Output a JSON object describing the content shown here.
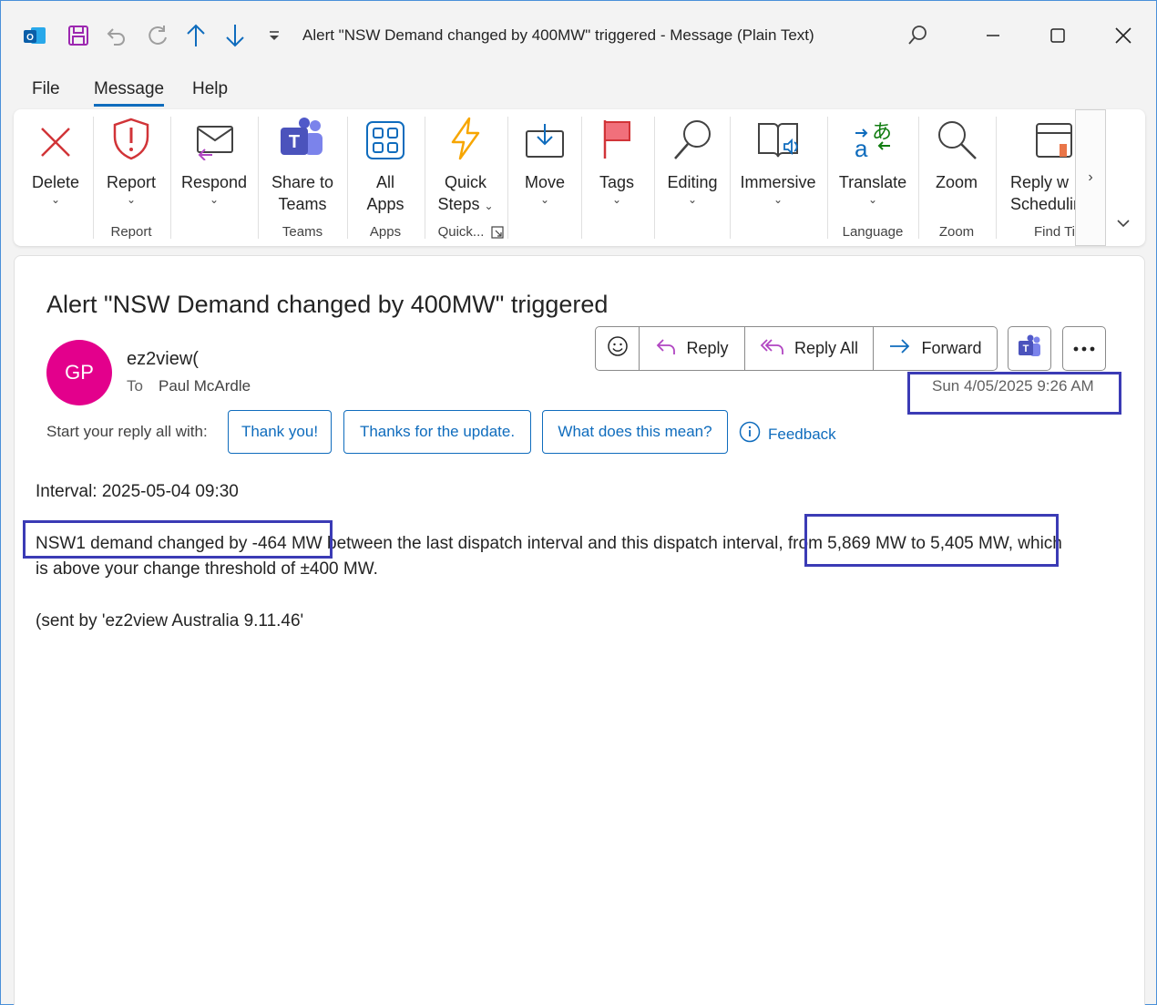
{
  "window": {
    "title": "Alert \"NSW Demand changed by 400MW\" triggered  -  Message (Plain Text)"
  },
  "quick_access": [
    "outlook-icon",
    "save-icon",
    "undo-icon",
    "redo-icon",
    "previous-item-icon",
    "next-item-icon",
    "customize-icon"
  ],
  "menu": {
    "tabs": [
      "File",
      "Message",
      "Help"
    ],
    "active": "Message"
  },
  "ribbon": {
    "buttons": {
      "delete": "Delete",
      "report": "Report",
      "respond": "Respond",
      "share_to_teams_1": "Share to",
      "share_to_teams_2": "Teams",
      "all_apps_1": "All",
      "all_apps_2": "Apps",
      "quick_steps_1": "Quick",
      "quick_steps_2": "Steps",
      "move": "Move",
      "tags": "Tags",
      "editing": "Editing",
      "immersive": "Immersive",
      "translate": "Translate",
      "zoom": "Zoom",
      "reply_scheduling_1": "Reply w",
      "reply_scheduling_2": "Schedulin"
    },
    "groups": {
      "report": "Report",
      "teams": "Teams",
      "apps": "Apps",
      "quick": "Quick...",
      "language": "Language",
      "zoom": "Zoom",
      "find_time": "Find Ti"
    }
  },
  "message": {
    "subject": "Alert \"NSW Demand changed by 400MW\" triggered",
    "avatar_initials": "GP",
    "sender": "ez2view(",
    "to_label": "To",
    "to_name": "Paul McArdle",
    "datetime": "Sun 4/05/2025 9:26 AM",
    "actions": {
      "reply": "Reply",
      "reply_all": "Reply All",
      "forward": "Forward"
    },
    "suggested_replies_label": "Start your reply all with:",
    "suggested_replies": [
      "Thank you!",
      "Thanks for the update.",
      "What does this mean?"
    ],
    "feedback": "Feedback",
    "body": {
      "interval": "Interval: 2025-05-04 09:30",
      "line1_part1": "NSW1 demand changed by -464 MW",
      "line1_part2": " between the last dispatch interval and this dispatch interval, ",
      "line1_part3": "from 5,869 MW to 5,405 MW,",
      "line1_part4": " which",
      "line2": "is above your change threshold of ±400 MW.",
      "sent_by": "(sent by 'ez2view Australia 9.11.46'"
    }
  },
  "colors": {
    "accent": "#0f6cbd",
    "avatar": "#e3008c",
    "highlight_box": "#3b3bb5",
    "delete_red": "#d13438"
  }
}
